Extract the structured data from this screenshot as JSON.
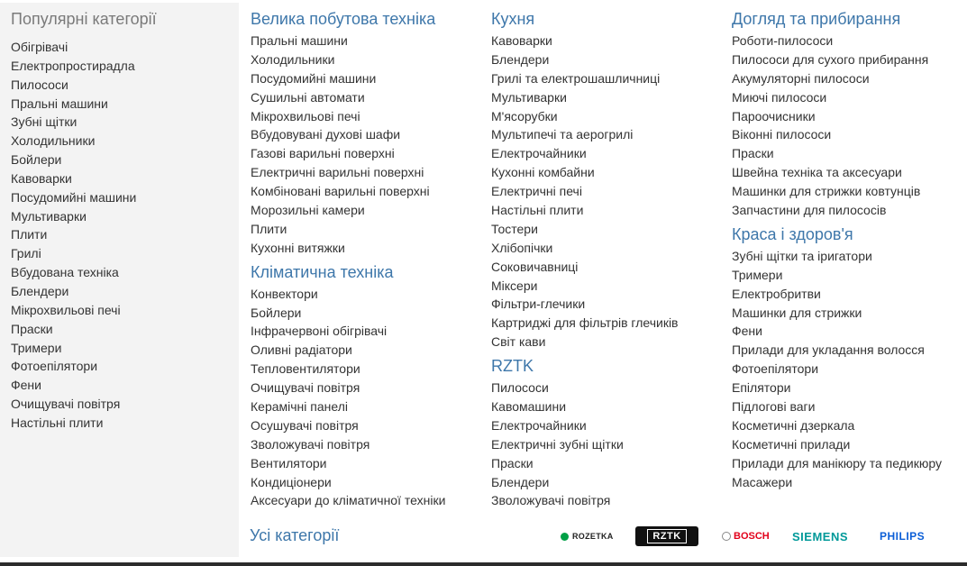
{
  "sidebar": {
    "title": "Популярні категорії",
    "items": [
      "Обігрівачі",
      "Електропростирадла",
      "Пилососи",
      "Пральні машини",
      "Зубні щітки",
      "Холодильники",
      "Бойлери",
      "Кавоварки",
      "Посудомийні машини",
      "Мультиварки",
      "Плити",
      "Грилі",
      "Вбудована техніка",
      "Блендери",
      "Мікрохвильові печі",
      "Праски",
      "Тримери",
      "Фотоепілятори",
      "Фени",
      "Очищувачі повітря",
      "Настільні плити"
    ]
  },
  "columns": [
    {
      "groups": [
        {
          "title": "Велика побутова техніка",
          "items": [
            "Пральні машини",
            "Холодильники",
            "Посудомийні машини",
            "Сушильні автомати",
            "Мікрохвильові печі",
            "Вбудовувані духові шафи",
            "Газові варильні поверхні",
            "Електричні варильні поверхні",
            "Комбіновані варильні поверхні",
            "Морозильні камери",
            "Плити",
            "Кухонні витяжки"
          ]
        },
        {
          "title": "Кліматична техніка",
          "items": [
            "Конвектори",
            "Бойлери",
            "Інфрачервоні обігрівачі",
            "Оливні радіатори",
            "Тепловентилятори",
            "Очищувачі повітря",
            "Керамічні панелі",
            "Осушувачі повітря",
            "Зволожувачі повітря",
            "Вентилятори",
            "Кондиціонери",
            "Аксесуари до кліматичної техніки"
          ]
        }
      ]
    },
    {
      "groups": [
        {
          "title": "Кухня",
          "items": [
            "Кавоварки",
            "Блендери",
            "Грилі та електрошашличниці",
            "Мультиварки",
            "М'ясорубки",
            "Мультипечі та аерогрилі",
            "Електрочайники",
            "Кухонні комбайни",
            "Електричні печі",
            "Настільні плити",
            "Тостери",
            "Хлібопічки",
            "Соковичавниці",
            "Міксери",
            "Фільтри-глечики",
            "Картриджі для фільтрів глечиків",
            "Світ кави"
          ]
        },
        {
          "title": "RZTK",
          "items": [
            "Пилососи",
            "Кавомашини",
            "Електрочайники",
            "Електричні зубні щітки",
            "Праски",
            "Блендери",
            "Зволожувачі повітря"
          ]
        }
      ]
    },
    {
      "groups": [
        {
          "title": "Догляд та прибирання",
          "items": [
            "Роботи-пилососи",
            "Пилососи для сухого прибирання",
            "Акумуляторні пилососи",
            "Миючі пилососи",
            "Пароочисники",
            "Віконні пилососи",
            "Праски",
            "Швейна техніка та аксесуари",
            "Машинки для стрижки ковтунців",
            "Запчастини для пилососів"
          ]
        },
        {
          "title": "Краса і здоров'я",
          "items": [
            "Зубні щітки та іригатори",
            "Тримери",
            "Електробритви",
            "Машинки для стрижки",
            "Фени",
            "Прилади для укладання волосся",
            "Фотоепілятори",
            "Епілятори",
            "Підлогові ваги",
            "Косметичні дзеркала",
            "Косметичні прилади",
            "Прилади для манікюру та педикюру",
            "Масажери"
          ]
        }
      ]
    }
  ],
  "footer": {
    "all_categories": "Усі категорії",
    "brands": {
      "rozetka": "ROZETKA",
      "rztk": "RZTK",
      "bosch": "BOSCH",
      "siemens": "SIEMENS",
      "philips": "PHILIPS"
    },
    "brand_colors": {
      "rozetka": "#00a046",
      "bosch": "#e2001a",
      "siemens": "#009999",
      "philips": "#0b5ed7"
    }
  },
  "colors": {
    "link_heading": "#3e77aa",
    "text": "#333333",
    "sidebar_bg": "#f3f3f3",
    "sidebar_title": "#7a7a7a"
  }
}
